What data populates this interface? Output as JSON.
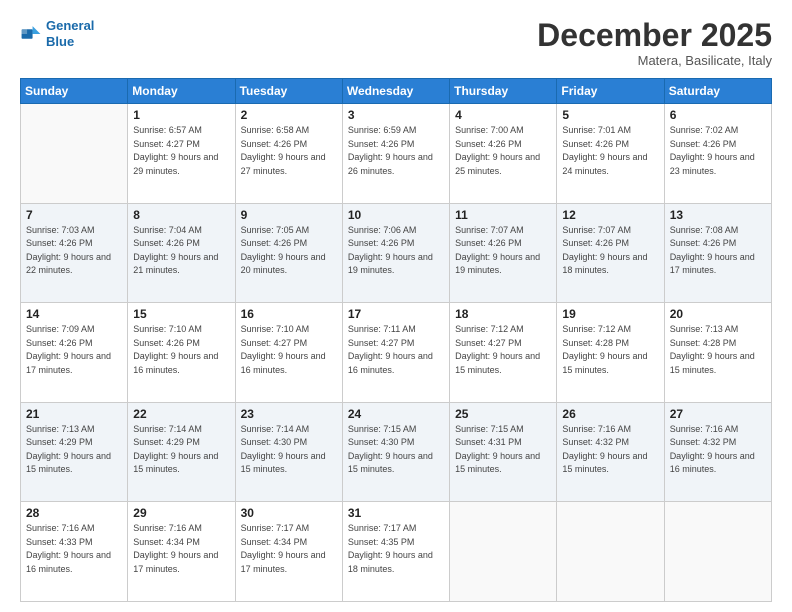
{
  "header": {
    "logo_line1": "General",
    "logo_line2": "Blue",
    "month": "December 2025",
    "location": "Matera, Basilicate, Italy"
  },
  "weekdays": [
    "Sunday",
    "Monday",
    "Tuesday",
    "Wednesday",
    "Thursday",
    "Friday",
    "Saturday"
  ],
  "weeks": [
    [
      {
        "day": "",
        "sunrise": "",
        "sunset": "",
        "daylight": ""
      },
      {
        "day": "1",
        "sunrise": "Sunrise: 6:57 AM",
        "sunset": "Sunset: 4:27 PM",
        "daylight": "Daylight: 9 hours and 29 minutes."
      },
      {
        "day": "2",
        "sunrise": "Sunrise: 6:58 AM",
        "sunset": "Sunset: 4:26 PM",
        "daylight": "Daylight: 9 hours and 27 minutes."
      },
      {
        "day": "3",
        "sunrise": "Sunrise: 6:59 AM",
        "sunset": "Sunset: 4:26 PM",
        "daylight": "Daylight: 9 hours and 26 minutes."
      },
      {
        "day": "4",
        "sunrise": "Sunrise: 7:00 AM",
        "sunset": "Sunset: 4:26 PM",
        "daylight": "Daylight: 9 hours and 25 minutes."
      },
      {
        "day": "5",
        "sunrise": "Sunrise: 7:01 AM",
        "sunset": "Sunset: 4:26 PM",
        "daylight": "Daylight: 9 hours and 24 minutes."
      },
      {
        "day": "6",
        "sunrise": "Sunrise: 7:02 AM",
        "sunset": "Sunset: 4:26 PM",
        "daylight": "Daylight: 9 hours and 23 minutes."
      }
    ],
    [
      {
        "day": "7",
        "sunrise": "Sunrise: 7:03 AM",
        "sunset": "Sunset: 4:26 PM",
        "daylight": "Daylight: 9 hours and 22 minutes."
      },
      {
        "day": "8",
        "sunrise": "Sunrise: 7:04 AM",
        "sunset": "Sunset: 4:26 PM",
        "daylight": "Daylight: 9 hours and 21 minutes."
      },
      {
        "day": "9",
        "sunrise": "Sunrise: 7:05 AM",
        "sunset": "Sunset: 4:26 PM",
        "daylight": "Daylight: 9 hours and 20 minutes."
      },
      {
        "day": "10",
        "sunrise": "Sunrise: 7:06 AM",
        "sunset": "Sunset: 4:26 PM",
        "daylight": "Daylight: 9 hours and 19 minutes."
      },
      {
        "day": "11",
        "sunrise": "Sunrise: 7:07 AM",
        "sunset": "Sunset: 4:26 PM",
        "daylight": "Daylight: 9 hours and 19 minutes."
      },
      {
        "day": "12",
        "sunrise": "Sunrise: 7:07 AM",
        "sunset": "Sunset: 4:26 PM",
        "daylight": "Daylight: 9 hours and 18 minutes."
      },
      {
        "day": "13",
        "sunrise": "Sunrise: 7:08 AM",
        "sunset": "Sunset: 4:26 PM",
        "daylight": "Daylight: 9 hours and 17 minutes."
      }
    ],
    [
      {
        "day": "14",
        "sunrise": "Sunrise: 7:09 AM",
        "sunset": "Sunset: 4:26 PM",
        "daylight": "Daylight: 9 hours and 17 minutes."
      },
      {
        "day": "15",
        "sunrise": "Sunrise: 7:10 AM",
        "sunset": "Sunset: 4:26 PM",
        "daylight": "Daylight: 9 hours and 16 minutes."
      },
      {
        "day": "16",
        "sunrise": "Sunrise: 7:10 AM",
        "sunset": "Sunset: 4:27 PM",
        "daylight": "Daylight: 9 hours and 16 minutes."
      },
      {
        "day": "17",
        "sunrise": "Sunrise: 7:11 AM",
        "sunset": "Sunset: 4:27 PM",
        "daylight": "Daylight: 9 hours and 16 minutes."
      },
      {
        "day": "18",
        "sunrise": "Sunrise: 7:12 AM",
        "sunset": "Sunset: 4:27 PM",
        "daylight": "Daylight: 9 hours and 15 minutes."
      },
      {
        "day": "19",
        "sunrise": "Sunrise: 7:12 AM",
        "sunset": "Sunset: 4:28 PM",
        "daylight": "Daylight: 9 hours and 15 minutes."
      },
      {
        "day": "20",
        "sunrise": "Sunrise: 7:13 AM",
        "sunset": "Sunset: 4:28 PM",
        "daylight": "Daylight: 9 hours and 15 minutes."
      }
    ],
    [
      {
        "day": "21",
        "sunrise": "Sunrise: 7:13 AM",
        "sunset": "Sunset: 4:29 PM",
        "daylight": "Daylight: 9 hours and 15 minutes."
      },
      {
        "day": "22",
        "sunrise": "Sunrise: 7:14 AM",
        "sunset": "Sunset: 4:29 PM",
        "daylight": "Daylight: 9 hours and 15 minutes."
      },
      {
        "day": "23",
        "sunrise": "Sunrise: 7:14 AM",
        "sunset": "Sunset: 4:30 PM",
        "daylight": "Daylight: 9 hours and 15 minutes."
      },
      {
        "day": "24",
        "sunrise": "Sunrise: 7:15 AM",
        "sunset": "Sunset: 4:30 PM",
        "daylight": "Daylight: 9 hours and 15 minutes."
      },
      {
        "day": "25",
        "sunrise": "Sunrise: 7:15 AM",
        "sunset": "Sunset: 4:31 PM",
        "daylight": "Daylight: 9 hours and 15 minutes."
      },
      {
        "day": "26",
        "sunrise": "Sunrise: 7:16 AM",
        "sunset": "Sunset: 4:32 PM",
        "daylight": "Daylight: 9 hours and 15 minutes."
      },
      {
        "day": "27",
        "sunrise": "Sunrise: 7:16 AM",
        "sunset": "Sunset: 4:32 PM",
        "daylight": "Daylight: 9 hours and 16 minutes."
      }
    ],
    [
      {
        "day": "28",
        "sunrise": "Sunrise: 7:16 AM",
        "sunset": "Sunset: 4:33 PM",
        "daylight": "Daylight: 9 hours and 16 minutes."
      },
      {
        "day": "29",
        "sunrise": "Sunrise: 7:16 AM",
        "sunset": "Sunset: 4:34 PM",
        "daylight": "Daylight: 9 hours and 17 minutes."
      },
      {
        "day": "30",
        "sunrise": "Sunrise: 7:17 AM",
        "sunset": "Sunset: 4:34 PM",
        "daylight": "Daylight: 9 hours and 17 minutes."
      },
      {
        "day": "31",
        "sunrise": "Sunrise: 7:17 AM",
        "sunset": "Sunset: 4:35 PM",
        "daylight": "Daylight: 9 hours and 18 minutes."
      },
      {
        "day": "",
        "sunrise": "",
        "sunset": "",
        "daylight": ""
      },
      {
        "day": "",
        "sunrise": "",
        "sunset": "",
        "daylight": ""
      },
      {
        "day": "",
        "sunrise": "",
        "sunset": "",
        "daylight": ""
      }
    ]
  ]
}
